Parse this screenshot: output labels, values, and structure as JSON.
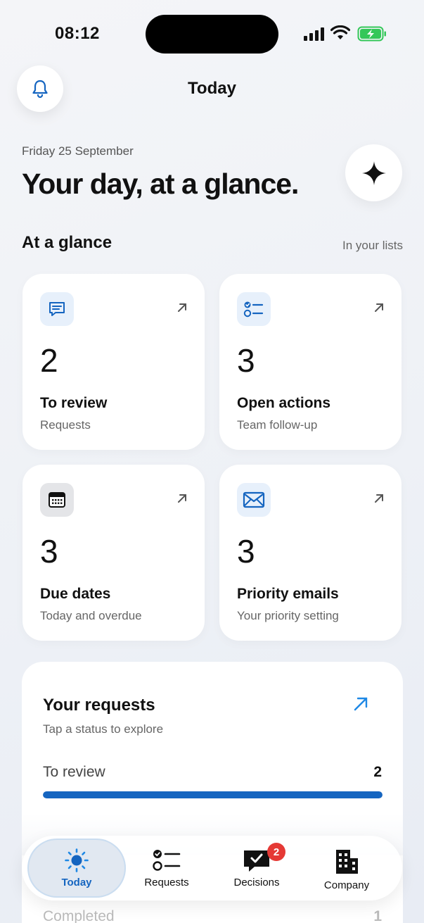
{
  "status_bar": {
    "time": "08:12"
  },
  "header": {
    "title": "Today"
  },
  "hero": {
    "date": "Friday 25 September",
    "headline": "Your day, at a glance."
  },
  "glance": {
    "title": "At a glance",
    "link": "In your lists",
    "cards": [
      {
        "count": "2",
        "label": "To review",
        "sub": "Requests",
        "icon": "chat-icon"
      },
      {
        "count": "3",
        "label": "Open actions",
        "sub": "Team follow-up",
        "icon": "checklist-icon"
      },
      {
        "count": "3",
        "label": "Due dates",
        "sub": "Today and overdue",
        "icon": "calendar-icon"
      },
      {
        "count": "3",
        "label": "Priority emails",
        "sub": "Your priority setting",
        "icon": "envelope-icon"
      }
    ]
  },
  "requests": {
    "title": "Your requests",
    "subtitle": "Tap a status to explore",
    "rows": [
      {
        "label": "To review",
        "value": "2",
        "progress": 1.0
      },
      {
        "label": "Completed",
        "value": "1"
      }
    ]
  },
  "tabbar": {
    "tabs": [
      {
        "label": "Today",
        "icon": "sun-icon",
        "active": true
      },
      {
        "label": "Requests",
        "icon": "checklist-icon"
      },
      {
        "label": "Decisions",
        "icon": "chat-check-icon",
        "badge": "2"
      },
      {
        "label": "Company",
        "icon": "building-icon"
      }
    ]
  },
  "colors": {
    "accent": "#1565c0",
    "badge": "#e53935",
    "battery": "#34c759"
  }
}
